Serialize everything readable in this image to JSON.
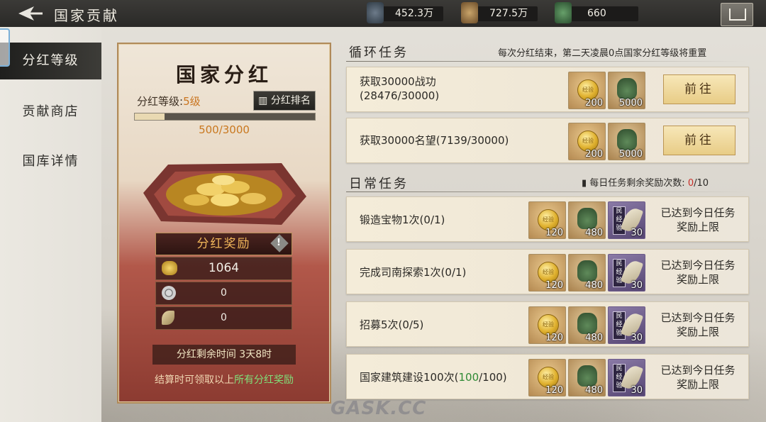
{
  "header": {
    "title": "国家贡献",
    "resources": [
      {
        "icon": "coin-sack-icon",
        "value": "452.3万"
      },
      {
        "icon": "grain-sack-icon",
        "value": "727.5万"
      },
      {
        "icon": "jade-pot-icon",
        "value": "660"
      }
    ]
  },
  "nav": {
    "items": [
      {
        "label": "分红等级",
        "active": true
      },
      {
        "label": "贡献商店",
        "active": false
      },
      {
        "label": "国库详情",
        "active": false
      }
    ]
  },
  "bonus": {
    "title": "国家分红",
    "level_label": "分红等级:",
    "level_value": "5级",
    "rank_button": "分红排名",
    "progress_text": "500/3000",
    "progress_ratio": 0.1667,
    "rewards_title": "分红奖励",
    "rewards": [
      {
        "icon": "gold-ingot-icon",
        "value": "1064"
      },
      {
        "icon": "copper-coin-icon",
        "value": "0"
      },
      {
        "icon": "wheat-icon",
        "value": "0"
      }
    ],
    "time_left": "分红剩余时间 3天8时",
    "note_prefix": "结算时可领取以上",
    "note_highlight": "所有分红奖励"
  },
  "cycle": {
    "title": "循环任务",
    "note": "每次分红结束，第二天凌晨0点国家分红等级将重置",
    "tasks": [
      {
        "name_line1": "获取30000战功",
        "name_line2": "(28476/30000)",
        "rewards": [
          {
            "type": "gold",
            "value": "200"
          },
          {
            "type": "jade",
            "value": "5000"
          }
        ],
        "action": "前往"
      },
      {
        "name_line1": "获取30000名望(7139/30000)",
        "name_line2": "",
        "rewards": [
          {
            "type": "gold",
            "value": "200"
          },
          {
            "type": "jade",
            "value": "5000"
          }
        ],
        "action": "前往"
      }
    ]
  },
  "daily": {
    "title": "日常任务",
    "count_label": "每日任务剩余奖励次数:",
    "count_current": "0",
    "count_total": "/10",
    "done_line1": "已达到今日任务",
    "done_line2": "奖励上限",
    "tasks": [
      {
        "name": "锻造宝物1次(0/1)",
        "prefix": "",
        "green": "",
        "suffix": "",
        "rewards": [
          {
            "type": "gold",
            "value": "120"
          },
          {
            "type": "jade",
            "value": "480"
          },
          {
            "type": "purple",
            "value": "30"
          }
        ]
      },
      {
        "name": "完成司南探索1次(0/1)",
        "prefix": "",
        "green": "",
        "suffix": "",
        "rewards": [
          {
            "type": "gold",
            "value": "120"
          },
          {
            "type": "jade",
            "value": "480"
          },
          {
            "type": "purple",
            "value": "30"
          }
        ]
      },
      {
        "name": "招募5次(0/5)",
        "prefix": "",
        "green": "",
        "suffix": "",
        "rewards": [
          {
            "type": "gold",
            "value": "120"
          },
          {
            "type": "jade",
            "value": "480"
          },
          {
            "type": "purple",
            "value": "30"
          }
        ]
      },
      {
        "name": "",
        "prefix": "国家建筑建设100次(",
        "green": "100",
        "suffix": "/100)",
        "rewards": [
          {
            "type": "gold",
            "value": "120"
          },
          {
            "type": "jade",
            "value": "480"
          },
          {
            "type": "purple",
            "value": "30"
          }
        ]
      }
    ]
  },
  "icon_text": {
    "coin": "经验",
    "scroll": "民经验"
  },
  "watermark": "GASK.CC"
}
